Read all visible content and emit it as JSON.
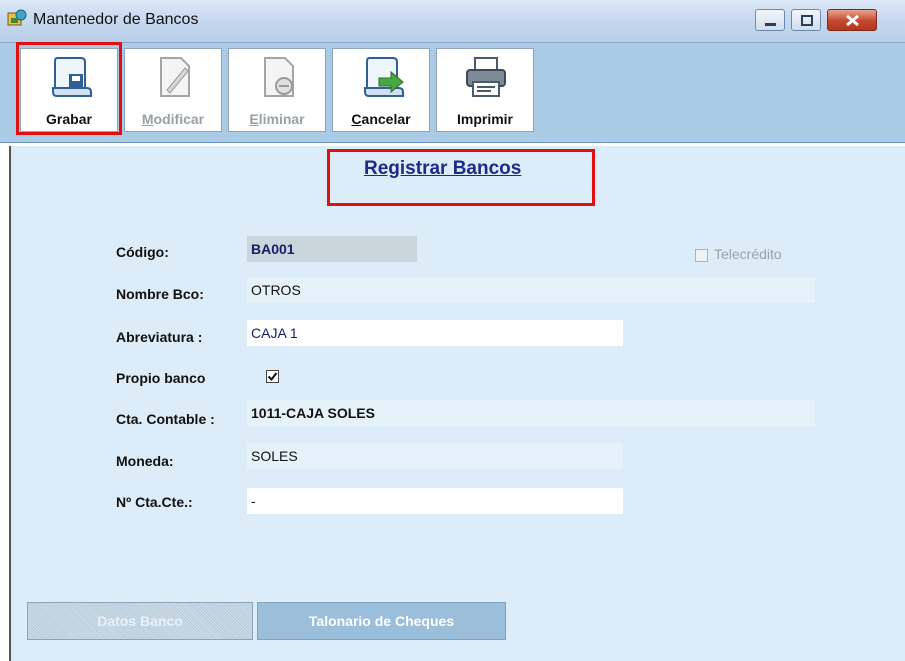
{
  "window": {
    "title": "Mantenedor de Bancos"
  },
  "toolbar": {
    "buttons": [
      {
        "label": "Grabar",
        "icon": "save-icon",
        "enabled": true
      },
      {
        "label": "Modificar",
        "icon": "edit-document-icon",
        "enabled": false
      },
      {
        "label": "Eliminar",
        "icon": "delete-document-icon",
        "enabled": false
      },
      {
        "label": "Cancelar",
        "icon": "cancel-icon",
        "enabled": true
      },
      {
        "label": "Imprimir",
        "icon": "printer-icon",
        "enabled": true
      }
    ]
  },
  "form": {
    "title": "Registrar Bancos",
    "codigo": {
      "label": "Código:",
      "value": "BA001"
    },
    "nombre": {
      "label": "Nombre Bco:",
      "value": "OTROS"
    },
    "abreviatura": {
      "label": "Abreviatura :",
      "value": "CAJA 1"
    },
    "propio": {
      "label": "Propio banco",
      "checked": true
    },
    "cta_contable": {
      "label": "Cta. Contable :",
      "value": "1011-CAJA SOLES"
    },
    "moneda": {
      "label": "Moneda:",
      "value": "SOLES"
    },
    "nro_cta": {
      "label": "Nº Cta.Cte.:",
      "value": "-"
    },
    "telecredito": {
      "label": "Telecrédito",
      "checked": false,
      "enabled": false
    }
  },
  "tabs": [
    {
      "label": "Datos Banco",
      "active": true
    },
    {
      "label": "Talonario de Cheques",
      "active": false
    }
  ],
  "colors": {
    "highlight": "#e01010",
    "toolbar_bg": "#aacbe5",
    "content_bg": "#dcecf8",
    "title_link": "#1d2a8a"
  }
}
